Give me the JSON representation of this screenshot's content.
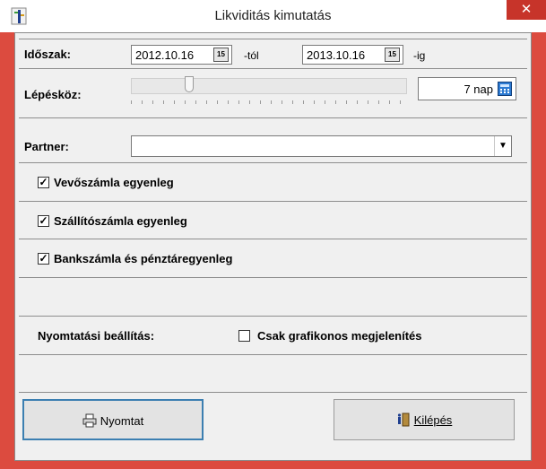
{
  "window": {
    "title": "Likviditás kimutatás",
    "close_glyph": "✕",
    "app_icon": "app-icon"
  },
  "period": {
    "label": "Időszak:",
    "from_date": "2012.10.16",
    "from_suffix": "-tól",
    "to_date": "2013.10.16",
    "to_suffix": "-ig",
    "calendar_icon_text": "15"
  },
  "step": {
    "label": "Lépésköz:",
    "value": "7 nap",
    "slider_fraction": 0.2
  },
  "partner": {
    "label": "Partner:",
    "value": ""
  },
  "options": [
    {
      "label": "Vevőszámla egyenleg",
      "checked": true
    },
    {
      "label": "Szállítószámla egyenleg",
      "checked": true
    },
    {
      "label": "Bankszámla és pénztáregyenleg",
      "checked": true
    }
  ],
  "print_settings": {
    "label": "Nyomtatási beállítás:",
    "graphic_only_label": "Csak grafikonos megjelenítés",
    "graphic_only_checked": false
  },
  "buttons": {
    "print_label": "Nyomtat",
    "exit_label": "Kilépés"
  },
  "colors": {
    "window_border": "#dc4b3f",
    "close_button": "#c7342a",
    "panel_bg": "#f0f0f0"
  }
}
